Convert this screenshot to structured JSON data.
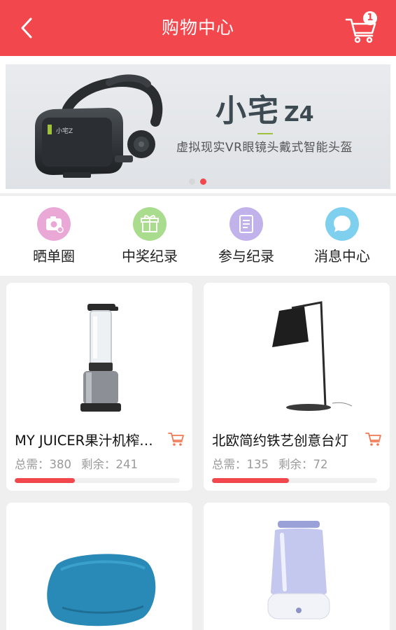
{
  "header": {
    "title": "购物中心",
    "cart_count": "1",
    "accent": "#f2474c"
  },
  "banner": {
    "brand": "小宅",
    "model": "Z4",
    "subtitle": "虚拟现实VR眼镜头戴式智能头盔",
    "slides": 2,
    "active_slide": 2
  },
  "quicknav": [
    {
      "label": "晒单圈",
      "icon": "camera-icon",
      "color": "#e9a8d6"
    },
    {
      "label": "中奖纪录",
      "icon": "gift-icon",
      "color": "#a9dc8d"
    },
    {
      "label": "参与纪录",
      "icon": "document-icon",
      "color": "#c1b2ec"
    },
    {
      "label": "消息中心",
      "icon": "chat-bubble-icon",
      "color": "#7fd0ef"
    }
  ],
  "products": [
    {
      "name": "MY JUICER果汁机榨汁机",
      "total_label": "总需：",
      "total": "380",
      "remain_label": "剩余：",
      "remain": "241",
      "progress": 0.366,
      "image": "juicer"
    },
    {
      "name": "北欧简约铁艺创意台灯",
      "total_label": "总需：",
      "total": "135",
      "remain_label": "剩余：",
      "remain": "72",
      "progress": 0.467,
      "image": "desk-lamp"
    },
    {
      "name": "",
      "image": "bean-bag"
    },
    {
      "name": "",
      "image": "humidifier"
    }
  ]
}
